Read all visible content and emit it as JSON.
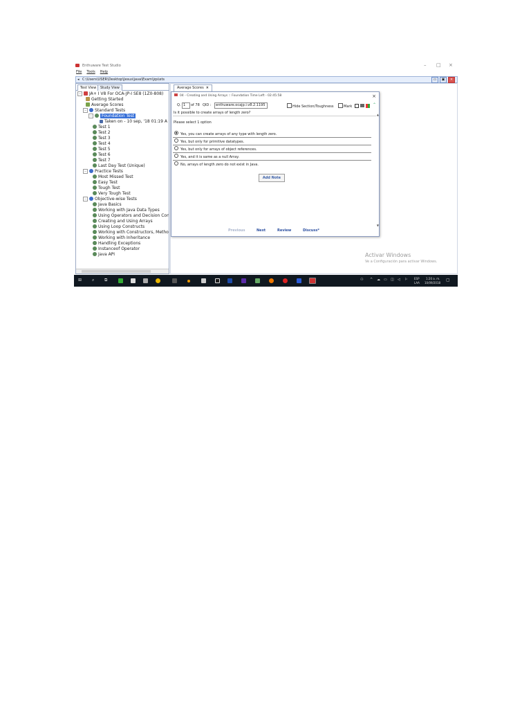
{
  "window": {
    "title": "Enthuware Test Studio",
    "minimize": "–",
    "maximize": "□",
    "close": "×"
  },
  "menu": {
    "file": "File",
    "tools": "Tools",
    "help": "Help"
  },
  "path": "C:\\Users\\USER\\Desktop\\Jesus\\java\\Exam\\jqs\\ets",
  "left_tabs": {
    "test_view": "Test View",
    "study_view": "Study View"
  },
  "tree": [
    "JA+ I V8 For OCA-JP-I SE8 (1Z0-808)",
    "Getting Started",
    "Average Scores",
    "Standard Tests",
    "Foundation Test",
    "Taken on - 10 sep, '18 01:19 A",
    "Test 1",
    "Test 2",
    "Test 3",
    "Test 4",
    "Test 5",
    "Test 6",
    "Test 7",
    "Last Day Test (Unique)",
    "Practice Tests",
    "Most Missed Test",
    "Easy Test",
    "Tough Test",
    "Very Tough Test",
    "Objective-wise Tests",
    "Java Basics",
    "Working with Java Data Types",
    "Using Operators and Decision Con",
    "Creating and Using Arrays",
    "Using Loop Constructs",
    "Working with Constructors, Metho",
    "Working with Inheritance",
    "Handling Exceptions",
    "Instanceof Operator",
    "Java API"
  ],
  "doc_tab": {
    "label": "Average Scores",
    "close": "×"
  },
  "dialog": {
    "title": "04 - Creating and Using Arrays :: Foundation  Time Left - 02:45:58",
    "close": "×",
    "q_label": "Q.",
    "q_number": "1",
    "q_of": "of 78",
    "qid_label": "QID :",
    "qid_value": "enthuware.ocajp.i.v8.2.1195",
    "hide_label": "Hide Section/Toughness",
    "mark_label": "Mark",
    "question": "Is it possible to create arrays of length zero?",
    "select_label": "Please select 1 option",
    "options": [
      "Yes, you can create arrays of any type with length zero.",
      "Yes, but only for primitive datatypes.",
      "Yes, but only for arrays of object references.",
      "Yes, and it is same as a null Array.",
      "No, arrays of length zero do not exist in Java."
    ],
    "add_note": "Add Note",
    "nav": {
      "previous": "Previous",
      "next": "Next",
      "review": "Review",
      "discuss": "Discuss*"
    }
  },
  "watermark": {
    "title": "Activar Windows",
    "subtitle": "Ve a Configuración para activar Windows."
  },
  "taskbar": {
    "lang_top": "ESP",
    "lang_bottom": "LAA",
    "time": "1:20 a. m.",
    "date": "10/09/2018"
  }
}
